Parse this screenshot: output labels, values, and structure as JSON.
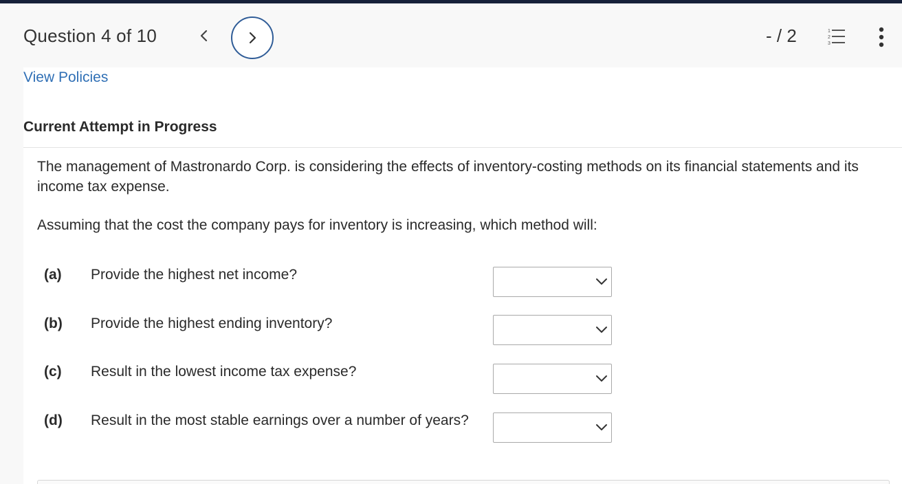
{
  "header": {
    "question_counter": "Question 4 of 10",
    "score": "- / 2"
  },
  "links": {
    "view_policies": "View Policies"
  },
  "attempt": {
    "heading": "Current Attempt in Progress"
  },
  "question": {
    "intro": "The management of Mastronardo Corp. is considering the effects of inventory-costing methods on its financial statements and its income tax expense.",
    "prompt": "Assuming that the cost the company pays for inventory is increasing, which method will:",
    "items": [
      {
        "letter": "(a)",
        "text": "Provide the highest net income?",
        "selected": ""
      },
      {
        "letter": "(b)",
        "text": "Provide the highest ending inventory?",
        "selected": ""
      },
      {
        "letter": "(c)",
        "text": "Result in the lowest income tax expense?",
        "selected": ""
      },
      {
        "letter": "(d)",
        "text": "Result in the most stable earnings over a number of years?",
        "selected": ""
      }
    ]
  },
  "icons": {
    "prev": "chevron-left-icon",
    "next": "chevron-right-icon",
    "list": "numbered-list-icon",
    "more": "more-vertical-icon",
    "dropdown": "chevron-down-icon"
  },
  "colors": {
    "link": "#2f6fb5",
    "next_button_border": "#2f5c97",
    "top_strip": "#16213a"
  }
}
